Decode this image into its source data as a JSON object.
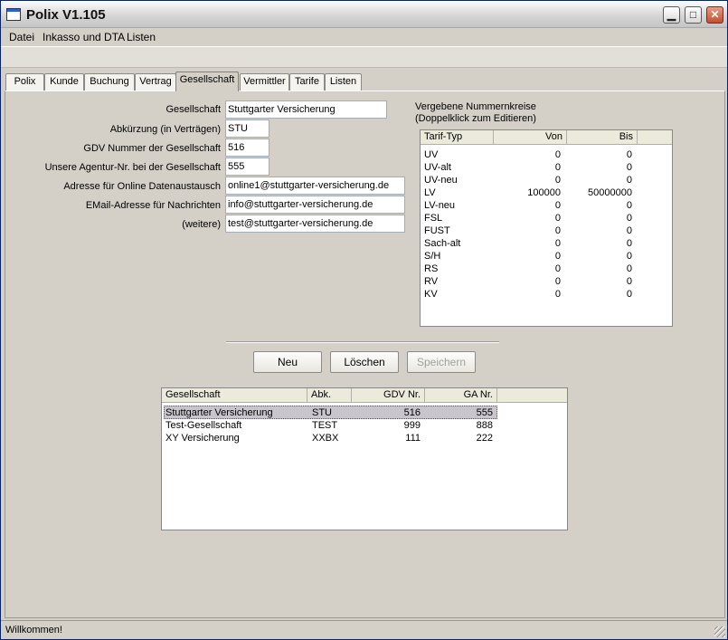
{
  "window": {
    "title": "Polix V1.105"
  },
  "menu": [
    "Datei",
    "Inkasso und DTA",
    "Listen"
  ],
  "tabs": [
    "Polix",
    "Kunde",
    "Buchung",
    "Vertrag",
    "Gesellschaft",
    "Vermittler",
    "Tarife",
    "Listen"
  ],
  "active_tab": "Gesellschaft",
  "form": {
    "fields": [
      {
        "label": "Gesellschaft",
        "value": "Stuttgarter Versicherung"
      },
      {
        "label": "Abkürzung (in Verträgen)",
        "value": "STU"
      },
      {
        "label": "GDV Nummer der Gesellschaft",
        "value": "516"
      },
      {
        "label": "Unsere Agentur-Nr. bei der Gesellschaft",
        "value": "555"
      },
      {
        "label": "Adresse für Online Datenaustausch",
        "value": "online1@stuttgarter-versicherung.de"
      },
      {
        "label": "EMail-Adresse für Nachrichten",
        "value": "info@stuttgarter-versicherung.de"
      },
      {
        "label": "(weitere)",
        "value": "test@stuttgarter-versicherung.de"
      }
    ]
  },
  "ranges": {
    "title_line1": "Vergebene Nummernkreise",
    "title_line2": "(Doppelklick zum Editieren)",
    "headers": [
      "Tarif-Typ",
      "Von",
      "Bis"
    ],
    "rows": [
      [
        "UV",
        "0",
        "0"
      ],
      [
        "UV-alt",
        "0",
        "0"
      ],
      [
        "UV-neu",
        "0",
        "0"
      ],
      [
        "LV",
        "100000",
        "50000000"
      ],
      [
        "LV-neu",
        "0",
        "0"
      ],
      [
        "FSL",
        "0",
        "0"
      ],
      [
        "FUST",
        "0",
        "0"
      ],
      [
        "Sach-alt",
        "0",
        "0"
      ],
      [
        "S/H",
        "0",
        "0"
      ],
      [
        "RS",
        "0",
        "0"
      ],
      [
        "RV",
        "0",
        "0"
      ],
      [
        "KV",
        "0",
        "0"
      ]
    ]
  },
  "buttons": {
    "new": "Neu",
    "delete": "Löschen",
    "save": "Speichern"
  },
  "companies": {
    "headers": [
      "Gesellschaft",
      "Abk.",
      "GDV Nr.",
      "GA Nr."
    ],
    "rows": [
      [
        "Stuttgarter Versicherung",
        "STU",
        "516",
        "555"
      ],
      [
        "Test-Gesellschaft",
        "TEST",
        "999",
        "888"
      ],
      [
        "XY Versicherung",
        "XXBX",
        "111",
        "222"
      ]
    ],
    "selected_index": 0
  },
  "status": "Willkommen!"
}
